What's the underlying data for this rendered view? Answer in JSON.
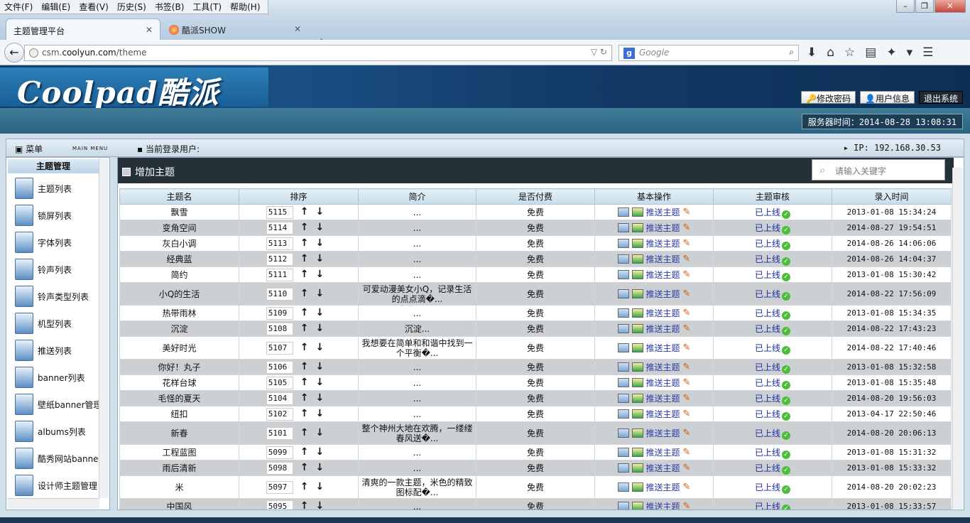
{
  "menubar": {
    "items": [
      "文件(F)",
      "编辑(E)",
      "查看(V)",
      "历史(S)",
      "书签(B)",
      "工具(T)",
      "帮助(H)"
    ]
  },
  "tabs": [
    {
      "label": "主题管理平台"
    },
    {
      "label": "酷派SHOW"
    }
  ],
  "newtab": "+",
  "address": {
    "prefix": "csm.",
    "host": "coolyun.com",
    "path": "/theme"
  },
  "search_engine": {
    "placeholder": "Google"
  },
  "header": {
    "logo_text": "Coolpad酷派",
    "buttons": {
      "change_password": "修改密码",
      "user_info": "用户信息",
      "logout": "退出系统"
    },
    "server_time": "服务器时间：2014-08-28 13:08:31"
  },
  "infobar": {
    "menu": "菜单",
    "main_menu": "MAIN MENU",
    "current_user": "当前登录用户:",
    "ip": "IP: 192.168.30.53"
  },
  "sidebar": {
    "header": "主题管理",
    "items": [
      "主题列表",
      "锁屏列表",
      "字体列表",
      "铃声列表",
      "铃声类型列表",
      "机型列表",
      "推送列表",
      "banner列表",
      "壁纸banner管理",
      "albums列表",
      "酷秀网站banner",
      "设计师主题管理"
    ]
  },
  "main": {
    "add_button": "增加主题",
    "search_placeholder": "请输入关键字",
    "columns": [
      "主题名",
      "排序",
      "简介",
      "是否付费",
      "基本操作",
      "主题审核",
      "录入时间"
    ],
    "push_label": "推送主题",
    "rows": [
      {
        "name": "飘雪",
        "order": "5115",
        "desc": "...",
        "paid": "免费",
        "status": "已上线",
        "time": "2013-01-08 15:34:24"
      },
      {
        "name": "变角空间",
        "order": "5114",
        "desc": "...",
        "paid": "免费",
        "status": "已上线",
        "time": "2014-08-27 19:54:51"
      },
      {
        "name": "灰白小调",
        "order": "5113",
        "desc": "...",
        "paid": "免费",
        "status": "已上线",
        "time": "2014-08-26 14:06:06"
      },
      {
        "name": "经典蓝",
        "order": "5112",
        "desc": "...",
        "paid": "免费",
        "status": "已上线",
        "time": "2014-08-26 14:04:37"
      },
      {
        "name": "简约",
        "order": "5111",
        "desc": "...",
        "paid": "免费",
        "status": "已上线",
        "time": "2013-01-08 15:30:42"
      },
      {
        "name": "小Q的生活",
        "order": "5110",
        "desc": "可爱动漫美女小Q，记录生活的点点滴�...",
        "paid": "免费",
        "status": "已上线",
        "time": "2014-08-22 17:56:09"
      },
      {
        "name": "热带雨林",
        "order": "5109",
        "desc": "...",
        "paid": "免费",
        "status": "已上线",
        "time": "2013-01-08 15:34:35"
      },
      {
        "name": "沉淀",
        "order": "5108",
        "desc": "沉淀...",
        "paid": "免费",
        "status": "已上线",
        "time": "2014-08-22 17:43:23"
      },
      {
        "name": "美好时光",
        "order": "5107",
        "desc": "我想要在简单和和谐中找到一个平衡�...",
        "paid": "免费",
        "status": "已上线",
        "time": "2014-08-22 17:40:46"
      },
      {
        "name": "你好！丸子",
        "order": "5106",
        "desc": "...",
        "paid": "免费",
        "status": "已上线",
        "time": "2013-01-08 15:32:58"
      },
      {
        "name": "花样台球",
        "order": "5105",
        "desc": "...",
        "paid": "免费",
        "status": "已上线",
        "time": "2013-01-08 15:35:48"
      },
      {
        "name": "毛怪的夏天",
        "order": "5104",
        "desc": "...",
        "paid": "免费",
        "status": "已上线",
        "time": "2014-08-20 19:56:03"
      },
      {
        "name": "纽扣",
        "order": "5102",
        "desc": "...",
        "paid": "免费",
        "status": "已上线",
        "time": "2013-04-17 22:50:46"
      },
      {
        "name": "新春",
        "order": "5101",
        "desc": "整个神州大地在欢腾，一缕缕春风送�...",
        "paid": "免费",
        "status": "已上线",
        "time": "2014-08-20 20:06:13"
      },
      {
        "name": "工程蓝图",
        "order": "5099",
        "desc": "...",
        "paid": "免费",
        "status": "已上线",
        "time": "2013-01-08 15:31:32"
      },
      {
        "name": "雨后清新",
        "order": "5098",
        "desc": "...",
        "paid": "免费",
        "status": "已上线",
        "time": "2013-01-08 15:33:32"
      },
      {
        "name": "米",
        "order": "5097",
        "desc": "清爽的一款主题，米色的精致图标配�...",
        "paid": "免费",
        "status": "已上线",
        "time": "2014-08-20 20:02:23"
      },
      {
        "name": "中国风",
        "order": "5095",
        "desc": "...",
        "paid": "免费",
        "status": "已上线",
        "time": "2013-01-08 15:33:57"
      }
    ]
  }
}
